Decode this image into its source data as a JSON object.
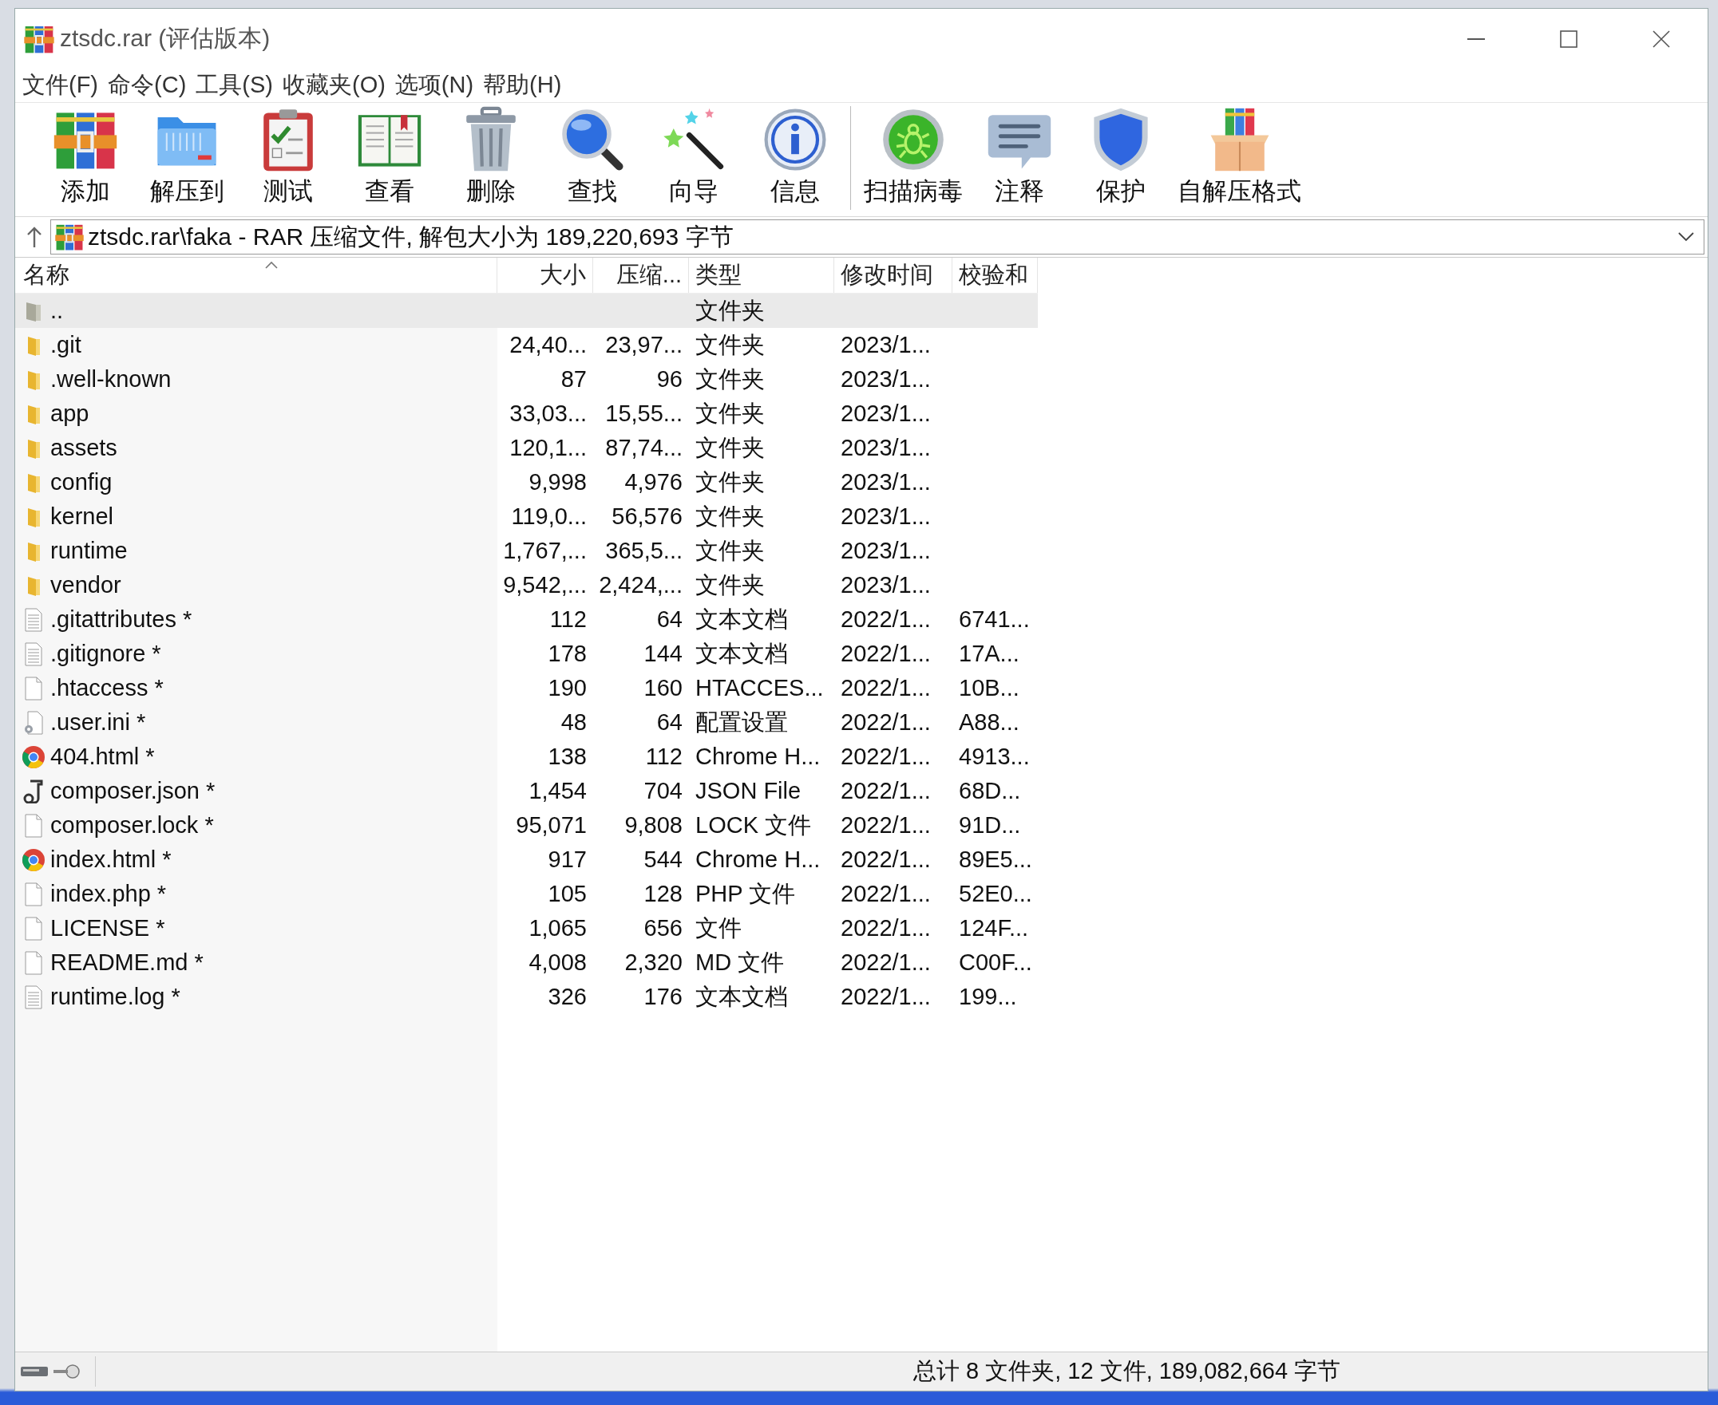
{
  "window": {
    "title": "ztsdc.rar (评估版本)"
  },
  "menu": [
    "文件(F)",
    "命令(C)",
    "工具(S)",
    "收藏夹(O)",
    "选项(N)",
    "帮助(H)"
  ],
  "toolbar": {
    "groups": [
      [
        {
          "label": "添加",
          "kind": "add"
        },
        {
          "label": "解压到",
          "kind": "extract"
        },
        {
          "label": "测试",
          "kind": "test"
        },
        {
          "label": "查看",
          "kind": "view"
        },
        {
          "label": "删除",
          "kind": "delete"
        },
        {
          "label": "查找",
          "kind": "find"
        },
        {
          "label": "向导",
          "kind": "wizard"
        },
        {
          "label": "信息",
          "kind": "info"
        }
      ],
      [
        {
          "label": "扫描病毒",
          "kind": "virus"
        },
        {
          "label": "注释",
          "kind": "comment"
        },
        {
          "label": "保护",
          "kind": "protect"
        },
        {
          "label": "自解压格式",
          "kind": "sfx"
        }
      ]
    ]
  },
  "address": {
    "path": "ztsdc.rar\\faka - RAR 压缩文件, 解包大小为 189,220,693 字节"
  },
  "table": {
    "columns": [
      {
        "label": "名称",
        "sorted": true
      },
      {
        "label": "大小",
        "sorted": false
      },
      {
        "label": "压缩...",
        "sorted": false
      },
      {
        "label": "类型",
        "sorted": false
      },
      {
        "label": "修改时间",
        "sorted": false
      },
      {
        "label": "校验和",
        "sorted": false
      }
    ],
    "rows": [
      {
        "name": "..",
        "kind": "parent",
        "type": "文件夹",
        "selected": true
      },
      {
        "name": ".git",
        "kind": "folder",
        "size": "24,40...",
        "packed": "23,97...",
        "type": "文件夹",
        "modified": "2023/1...",
        "selected": false
      },
      {
        "name": ".well-known",
        "kind": "folder",
        "size": "87",
        "packed": "96",
        "type": "文件夹",
        "modified": "2023/1...",
        "selected": false
      },
      {
        "name": "app",
        "kind": "folder",
        "size": "33,03...",
        "packed": "15,55...",
        "type": "文件夹",
        "modified": "2023/1...",
        "selected": false
      },
      {
        "name": "assets",
        "kind": "folder",
        "size": "120,1...",
        "packed": "87,74...",
        "type": "文件夹",
        "modified": "2023/1...",
        "selected": false
      },
      {
        "name": "config",
        "kind": "folder",
        "size": "9,998",
        "packed": "4,976",
        "type": "文件夹",
        "modified": "2023/1...",
        "selected": false
      },
      {
        "name": "kernel",
        "kind": "folder",
        "size": "119,0...",
        "packed": "56,576",
        "type": "文件夹",
        "modified": "2023/1...",
        "selected": false
      },
      {
        "name": "runtime",
        "kind": "folder",
        "size": "1,767,...",
        "packed": "365,5...",
        "type": "文件夹",
        "modified": "2023/1...",
        "selected": false
      },
      {
        "name": "vendor",
        "kind": "folder",
        "size": "9,542,...",
        "packed": "2,424,...",
        "type": "文件夹",
        "modified": "2023/1...",
        "selected": false
      },
      {
        "name": ".gitattributes *",
        "kind": "text",
        "size": "112",
        "packed": "64",
        "type": "文本文档",
        "modified": "2022/1...",
        "checksum": "6741...",
        "selected": false
      },
      {
        "name": ".gitignore *",
        "kind": "text",
        "size": "178",
        "packed": "144",
        "type": "文本文档",
        "modified": "2022/1...",
        "checksum": "17A...",
        "selected": false
      },
      {
        "name": ".htaccess *",
        "kind": "blank",
        "size": "190",
        "packed": "160",
        "type": "HTACCES...",
        "modified": "2022/1...",
        "checksum": "10B...",
        "selected": false
      },
      {
        "name": ".user.ini *",
        "kind": "settings",
        "size": "48",
        "packed": "64",
        "type": "配置设置",
        "modified": "2022/1...",
        "checksum": "A88...",
        "selected": false
      },
      {
        "name": "404.html *",
        "kind": "browser",
        "size": "138",
        "packed": "112",
        "type": "Chrome H...",
        "modified": "2022/1...",
        "checksum": "4913...",
        "selected": false
      },
      {
        "name": "composer.json *",
        "kind": "json",
        "size": "1,454",
        "packed": "704",
        "type": "JSON File",
        "modified": "2022/1...",
        "checksum": "68D...",
        "selected": false
      },
      {
        "name": "composer.lock *",
        "kind": "blank",
        "size": "95,071",
        "packed": "9,808",
        "type": "LOCK 文件",
        "modified": "2022/1...",
        "checksum": "91D...",
        "selected": false
      },
      {
        "name": "index.html *",
        "kind": "browser",
        "size": "917",
        "packed": "544",
        "type": "Chrome H...",
        "modified": "2022/1...",
        "checksum": "89E5...",
        "selected": false
      },
      {
        "name": "index.php *",
        "kind": "blank",
        "size": "105",
        "packed": "128",
        "type": "PHP 文件",
        "modified": "2022/1...",
        "checksum": "52E0...",
        "selected": false
      },
      {
        "name": "LICENSE *",
        "kind": "blank",
        "size": "1,065",
        "packed": "656",
        "type": "文件",
        "modified": "2022/1...",
        "checksum": "124F...",
        "selected": false
      },
      {
        "name": "README.md *",
        "kind": "blank",
        "size": "4,008",
        "packed": "2,320",
        "type": "MD 文件",
        "modified": "2022/1...",
        "checksum": "C00F...",
        "selected": false
      },
      {
        "name": "runtime.log *",
        "kind": "text",
        "size": "326",
        "packed": "176",
        "type": "文本文档",
        "modified": "2022/1...",
        "checksum": "199...",
        "selected": false
      }
    ]
  },
  "status_bar": {
    "text": "总计 8 文件夹, 12 文件, 189,082,664 字节"
  }
}
